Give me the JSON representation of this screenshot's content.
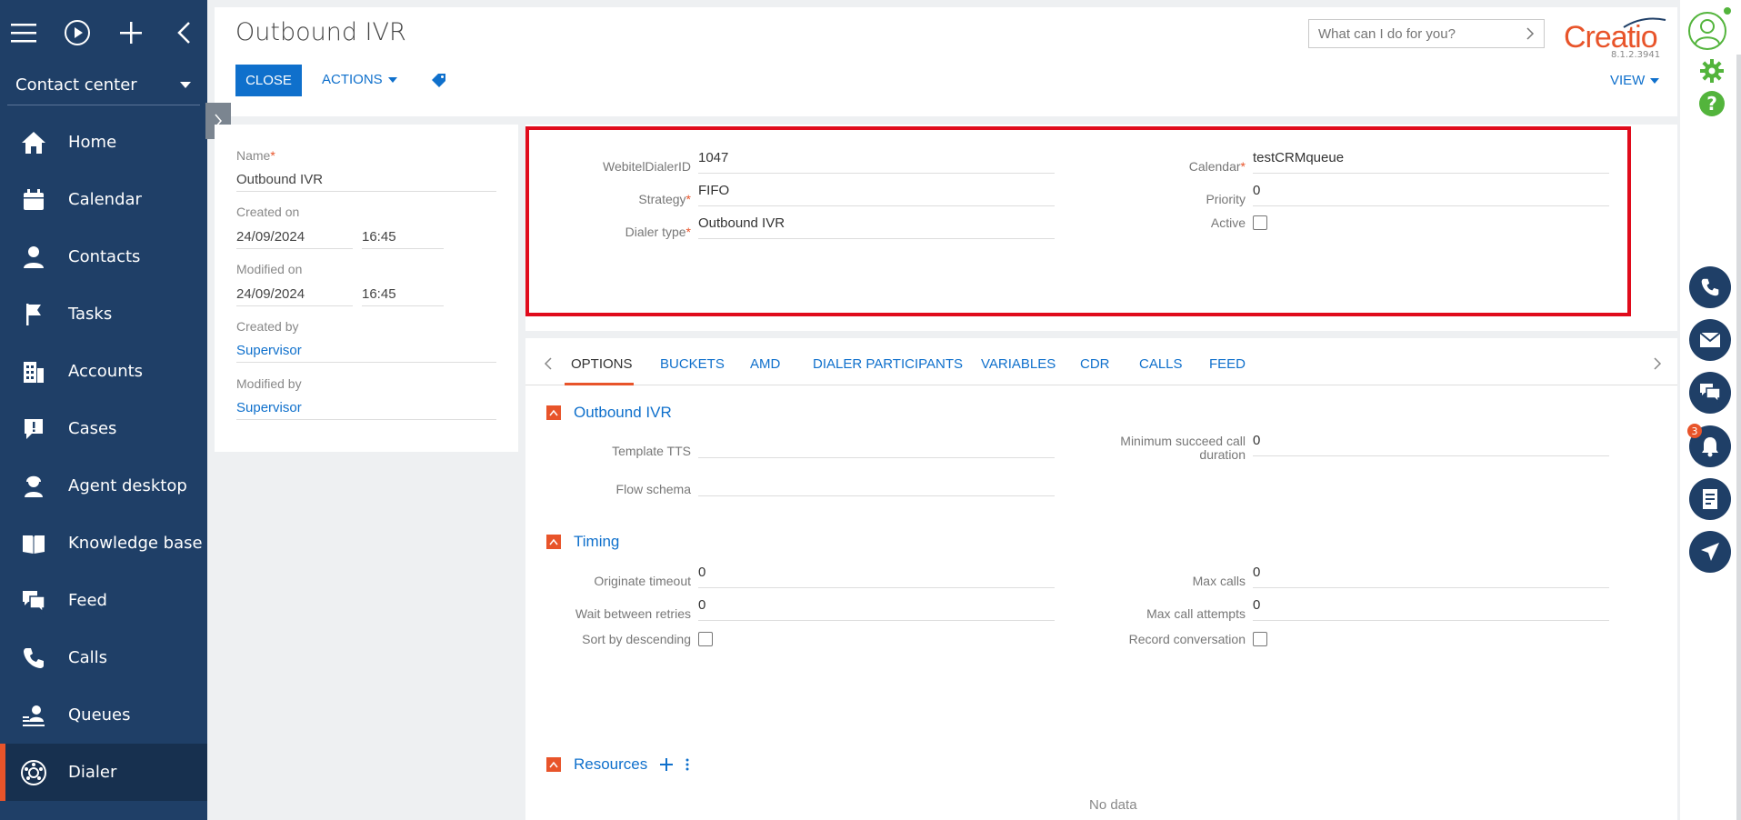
{
  "sidebar": {
    "workspace": "Contact center",
    "items": [
      {
        "label": "Home",
        "icon": "home-icon"
      },
      {
        "label": "Calendar",
        "icon": "calendar-icon"
      },
      {
        "label": "Contacts",
        "icon": "contact-icon"
      },
      {
        "label": "Tasks",
        "icon": "flag-icon"
      },
      {
        "label": "Accounts",
        "icon": "building-icon"
      },
      {
        "label": "Cases",
        "icon": "alert-icon"
      },
      {
        "label": "Agent desktop",
        "icon": "agent-icon"
      },
      {
        "label": "Knowledge base",
        "icon": "book-icon"
      },
      {
        "label": "Feed",
        "icon": "feed-icon"
      },
      {
        "label": "Calls",
        "icon": "phone-icon"
      },
      {
        "label": "Queues",
        "icon": "queue-icon"
      },
      {
        "label": "Dialer",
        "icon": "dialer-icon"
      }
    ],
    "active": "Dialer"
  },
  "header": {
    "title": "Outbound IVR",
    "close_label": "CLOSE",
    "actions_label": "ACTIONS",
    "search_placeholder": "What can I do for you?",
    "logo": "Creatio",
    "version": "8.1.2.3941",
    "view_label": "VIEW"
  },
  "info": {
    "name_label": "Name",
    "name_value": "Outbound IVR",
    "created_on_label": "Created on",
    "created_date": "24/09/2024",
    "created_time": "16:45",
    "modified_on_label": "Modified on",
    "modified_date": "24/09/2024",
    "modified_time": "16:45",
    "created_by_label": "Created by",
    "created_by": "Supervisor",
    "modified_by_label": "Modified by",
    "modified_by": "Supervisor"
  },
  "main": {
    "webitel_label": "WebitelDialerID",
    "webitel_value": "1047",
    "strategy_label": "Strategy",
    "strategy_value": "FIFO",
    "dialer_type_label": "Dialer type",
    "dialer_type_value": "Outbound IVR",
    "calendar_label": "Calendar",
    "calendar_value": "testCRMqueue",
    "priority_label": "Priority",
    "priority_value": "0",
    "active_label": "Active"
  },
  "tabs": [
    "OPTIONS",
    "BUCKETS",
    "AMD",
    "DIALER PARTICIPANTS",
    "VARIABLES",
    "CDR",
    "CALLS",
    "FEED"
  ],
  "options": {
    "group1_title": "Outbound IVR",
    "template_tts_label": "Template TTS",
    "flow_schema_label": "Flow schema",
    "min_succeed_label_1": "Minimum succeed call",
    "min_succeed_label_2": "duration",
    "min_succeed_value": "0",
    "group2_title": "Timing",
    "originate_label": "Originate timeout",
    "originate_value": "0",
    "wait_label": "Wait between retries",
    "wait_value": "0",
    "sort_label": "Sort by descending",
    "max_calls_label": "Max calls",
    "max_calls_value": "0",
    "max_attempts_label": "Max call attempts",
    "max_attempts_value": "0",
    "record_label": "Record conversation",
    "group3_title": "Resources",
    "no_data": "No data"
  },
  "rail": {
    "notification_count": "3",
    "help": "?"
  }
}
